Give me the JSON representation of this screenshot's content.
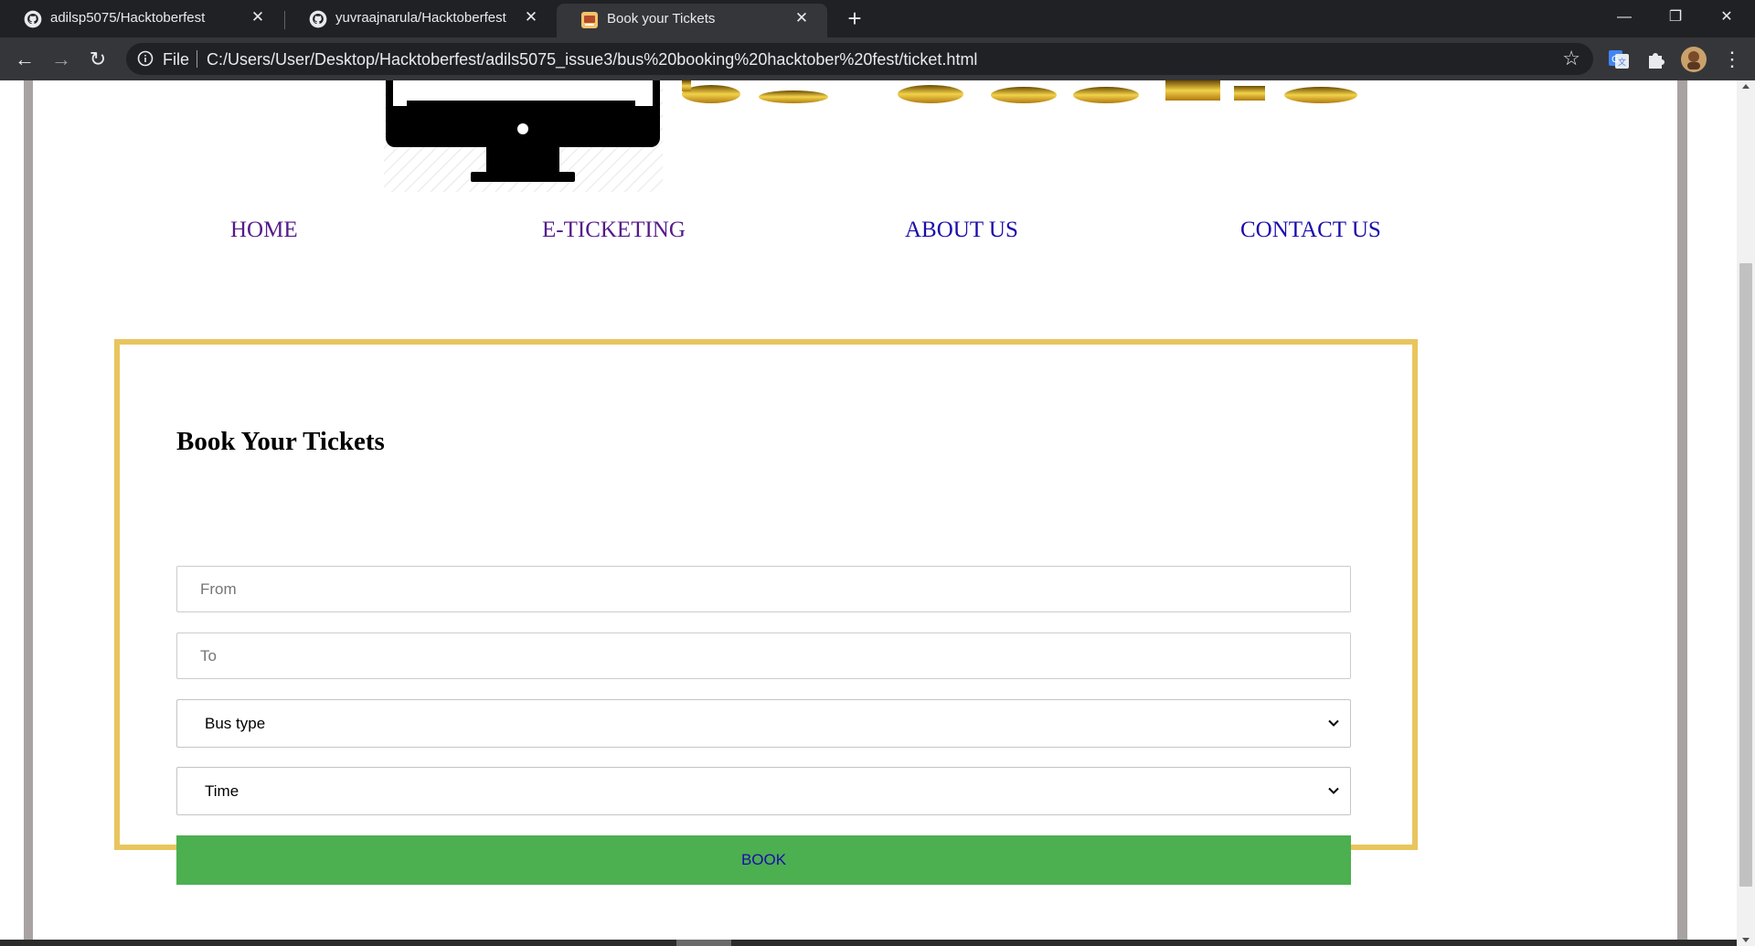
{
  "browser": {
    "tabs": [
      {
        "title": "adilsp5075/Hacktoberfest",
        "icon": "github-icon",
        "active": false
      },
      {
        "title": "yuvraajnarula/Hacktoberfest",
        "icon": "github-icon",
        "active": false
      },
      {
        "title": "Book your Tickets",
        "icon": "page-favicon",
        "active": true
      }
    ],
    "tab_close": "✕",
    "new_tab": "+",
    "window_controls": {
      "minimize": "—",
      "restore": "❐",
      "close": "✕"
    },
    "nav": {
      "back": "←",
      "forward": "→",
      "reload": "↻"
    },
    "omnibox": {
      "scheme_label": "File",
      "url": "C:/Users/User/Desktop/Hacktoberfest/adils5075_issue3/bus%20booking%20hacktober%20fest/ticket.html",
      "star": "☆"
    },
    "menu": "⋮"
  },
  "page": {
    "nav": {
      "home": "HOME",
      "eticketing": "E-TICKETING",
      "about": "ABOUT US",
      "contact": "CONTACT US"
    },
    "form": {
      "title": "Book Your Tickets",
      "from_placeholder": "From",
      "to_placeholder": "To",
      "bus_type_value": "Bus type",
      "time_value": "Time",
      "book_label": "BOOK"
    }
  },
  "colors": {
    "box_border": "#e8c55e",
    "book_button": "#4caf50",
    "nav_visited": "#551a8b",
    "nav_link": "#1a0dab"
  }
}
